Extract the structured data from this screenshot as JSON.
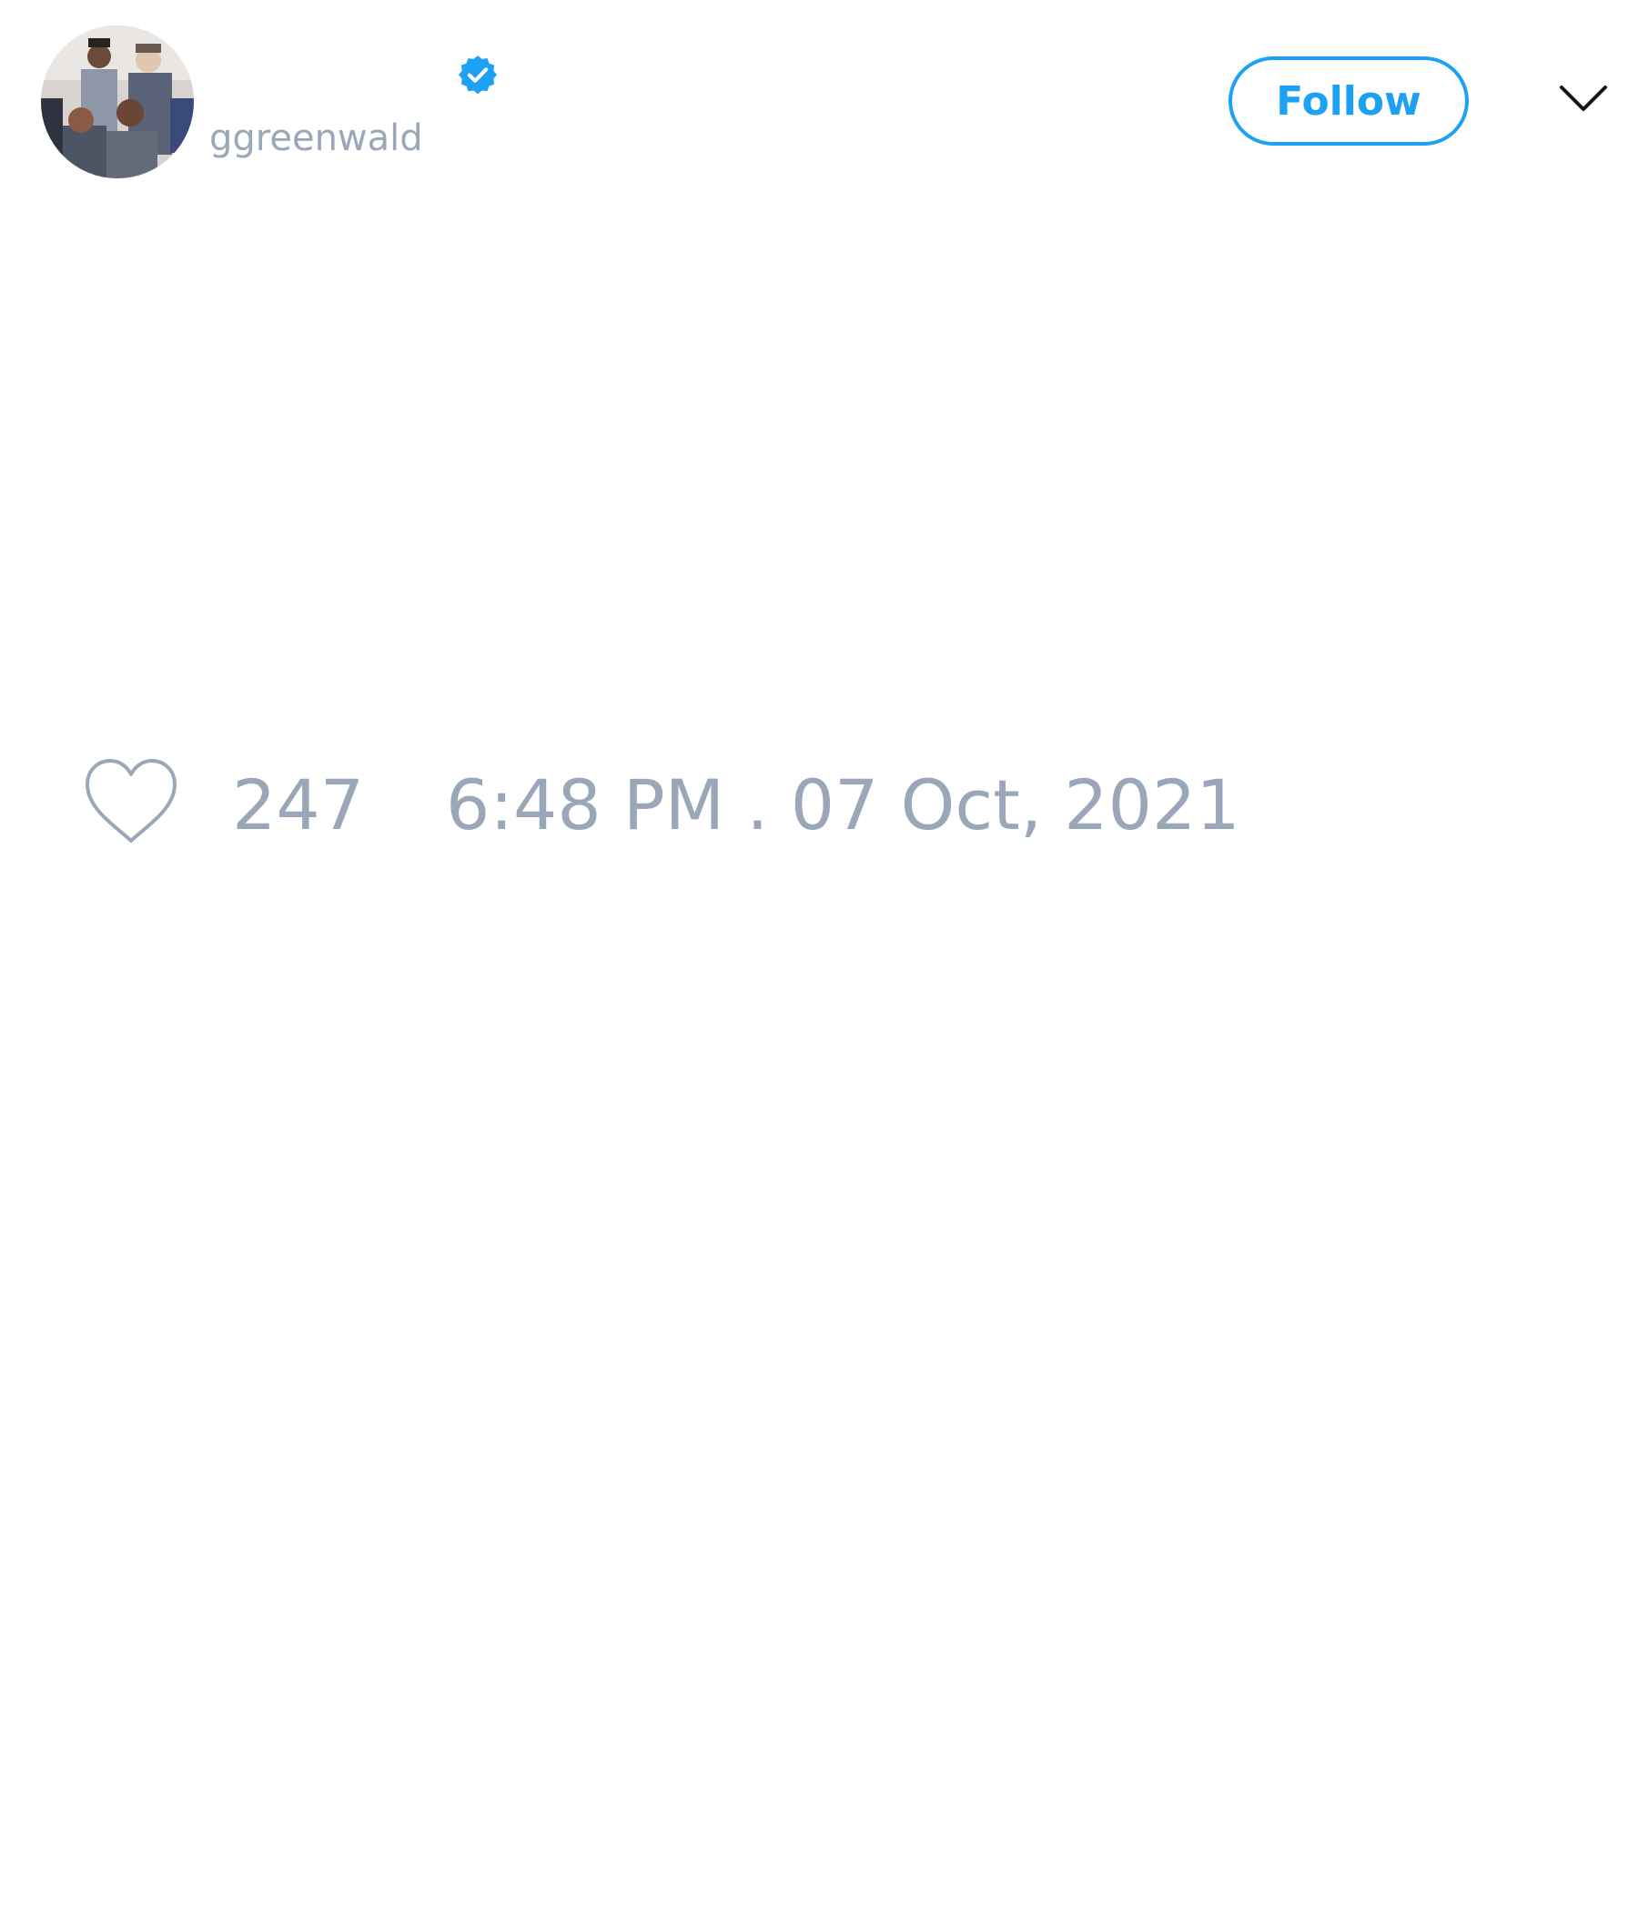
{
  "author": {
    "display_name": "",
    "handle": "ggreenwald",
    "verified": true,
    "avatar": "profile-photo-group-of-four-people"
  },
  "actions": {
    "follow_label": "Follow",
    "menu_icon": "chevron-down-icon"
  },
  "tweet": {
    "text": ""
  },
  "stats": {
    "like_icon": "heart-outline-icon",
    "like_count": "247",
    "timestamp": "6:48 PM . 07 Oct, 2021"
  },
  "colors": {
    "accent": "#1da1f2",
    "muted_text": "#9aa7b8",
    "background": "#ffffff"
  }
}
